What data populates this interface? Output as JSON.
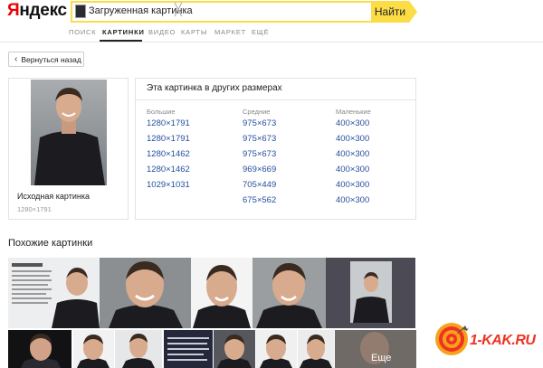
{
  "header": {
    "logo_first": "Я",
    "logo_rest": "ндекс",
    "search_query": "Загруженная картинка",
    "clear_glyph": "╳",
    "find_label": "Найти"
  },
  "nav": {
    "tabs": [
      {
        "label": "ПОИСК"
      },
      {
        "label": "КАРТИНКИ"
      },
      {
        "label": "ВИДЕО"
      },
      {
        "label": "КАРТЫ"
      },
      {
        "label": "МАРКЕТ"
      },
      {
        "label": "ЕЩЁ"
      }
    ],
    "active_tab": "КАРТИНКИ"
  },
  "back": {
    "label": "Вернуться назад",
    "icon": "chevron-left-icon"
  },
  "original": {
    "label": "Исходная картинка",
    "size": "1280×1791"
  },
  "sizes": {
    "title": "Эта картинка в других размерах",
    "large": {
      "header": "Большие",
      "items": [
        "1280×1791",
        "1280×1791",
        "1280×1462",
        "1280×1462",
        "1029×1031"
      ]
    },
    "medium": {
      "header": "Средние",
      "items": [
        "975×673",
        "975×673",
        "975×673",
        "969×669",
        "705×449",
        "675×562"
      ]
    },
    "small": {
      "header": "Маленькие",
      "items": [
        "400×300",
        "400×300",
        "400×300",
        "400×300",
        "400×300",
        "400×300"
      ]
    }
  },
  "similar": {
    "title": "Похожие картинки",
    "more_label": "Еще"
  },
  "watermark": {
    "text": "1-KAK.RU"
  },
  "colors": {
    "accent_yellow": "#fcdd46",
    "link_blue": "#264e9e",
    "logo_red": "#ee0000"
  }
}
